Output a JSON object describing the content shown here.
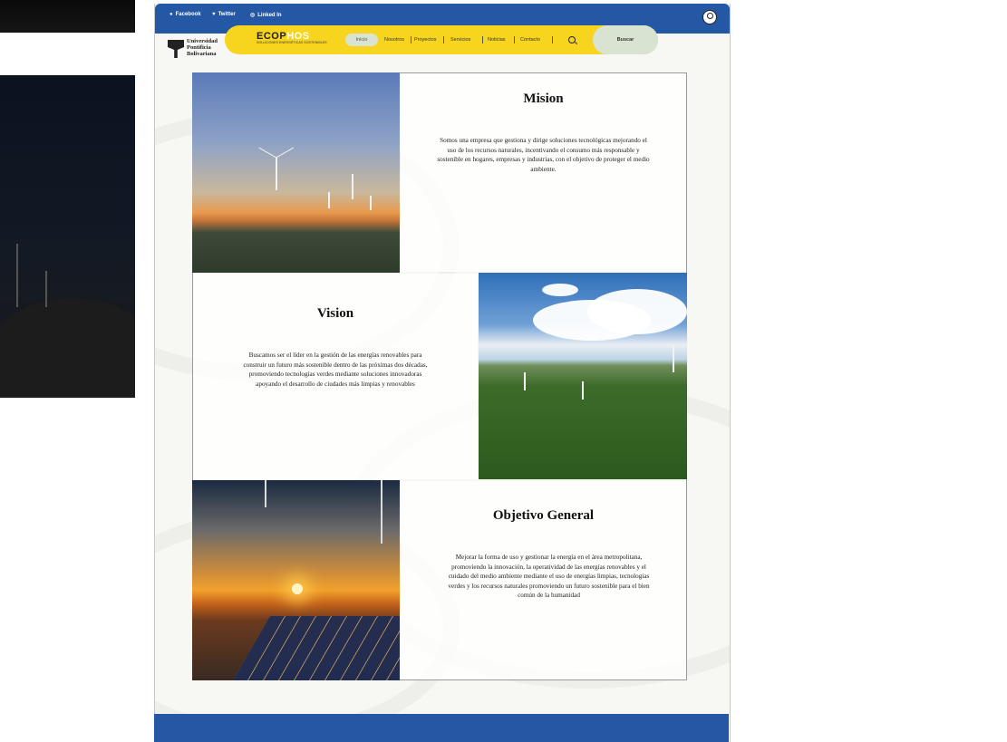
{
  "topbar": {
    "social": [
      {
        "label": "Facebook",
        "icon": "facebook-icon"
      },
      {
        "label": "Twitter",
        "icon": "twitter-icon"
      },
      {
        "label": "Linked In",
        "icon": "linkedin-icon"
      }
    ]
  },
  "logo": {
    "line1": "Universidad",
    "line2": "Pontificia",
    "line3": "Bolivariana"
  },
  "brand": {
    "name_a": "ECOP",
    "name_b": "HOS",
    "tagline": "SOLUCIONES ENERGÉTICAS SOSTENIBLES"
  },
  "nav": {
    "items": [
      "Inicio",
      "Nosotros",
      "Proyectos",
      "Servicios",
      "Noticias",
      "Contacto"
    ],
    "search_button": "Buscar"
  },
  "sections": {
    "mision": {
      "title": "Mision",
      "text": "Somos una empresa que gestiona y dirige soluciones tecnológicas mejorando el uso de los recursos naturales, incentivando el consumo más responsable y sostenible en hogares, empresas y industrias, con el objetivo de proteger el medio ambiente."
    },
    "vision": {
      "title": "Vision",
      "text": "Buscamos ser el líder en la gestión de las energías renovables para construir un futuro más sostenible dentro de las próximas dos décadas, promoviendo tecnologías verdes mediante soluciones innovadoras apoyando el desarrollo de ciudades más limpias y renovables"
    },
    "objetivo": {
      "title": "Objetivo General",
      "text": "Mejorar la forma de uso y gestionar la energía en el área metropolitana, promoviendo la innovación, la operatividad de las energías renovables y el cuidado del medio ambiente mediante el uso de energías limpias, tecnologías verdes y los recursos naturales promoviendo un futuro sostenible para el bien común de la humanidad"
    }
  },
  "colors": {
    "primary": "#2457a4",
    "accent": "#f7d41d",
    "soft": "#d8e3d2"
  }
}
